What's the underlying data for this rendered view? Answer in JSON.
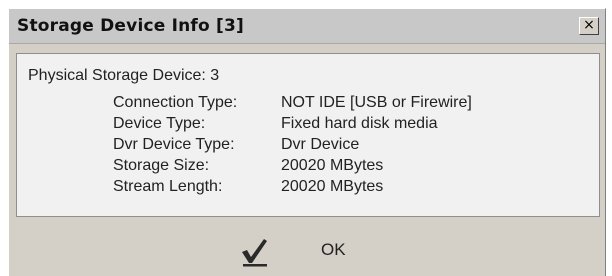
{
  "dialog": {
    "title": "Storage Device Info [3]",
    "close_glyph": "×"
  },
  "info": {
    "header": "Physical Storage Device: 3",
    "rows": [
      {
        "label": "Connection Type:",
        "value": "NOT IDE [USB or Firewire]"
      },
      {
        "label": "Device Type:",
        "value": "Fixed hard disk media"
      },
      {
        "label": "Dvr Device Type:",
        "value": "Dvr Device"
      },
      {
        "label": "Storage Size:",
        "value": "20020 MBytes"
      },
      {
        "label": "Stream Length:",
        "value": "20020 MBytes"
      }
    ]
  },
  "buttons": {
    "ok_label": "OK",
    "ok_icon": "checkmark-icon"
  }
}
